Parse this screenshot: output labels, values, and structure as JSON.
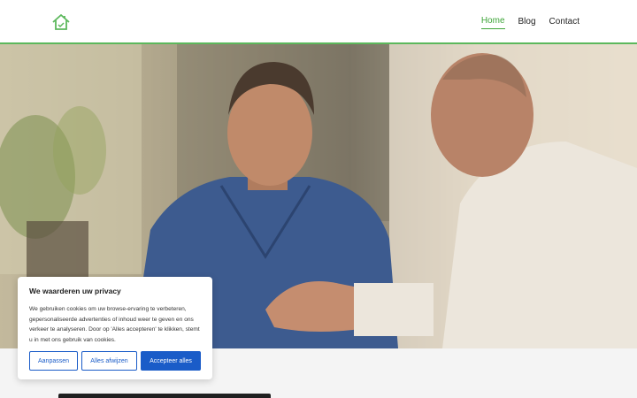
{
  "nav": {
    "items": [
      {
        "label": "Home",
        "active": true
      },
      {
        "label": "Blog",
        "active": false
      },
      {
        "label": "Contact",
        "active": false
      }
    ]
  },
  "logo": {
    "icon": "house-icon",
    "color": "#5cb85c"
  },
  "hero": {
    "image": "two-men-business-conversation-photo"
  },
  "cookie_banner": {
    "title": "We waarderen uw privacy",
    "text": "We gebruiken cookies om uw browse-ervaring te verbeteren, gepersonaliseerde advertenties of inhoud weer te geven en ons verkeer te analyseren. Door op 'Alles accepteren' te klikken, stemt u in met ons gebruik van cookies.",
    "buttons": {
      "customize": "Aanpassen",
      "reject": "Alles afwijzen",
      "accept": "Accepteer alles"
    },
    "accent_color": "#1a5cc8"
  },
  "colors": {
    "brand": "#3fa53a"
  }
}
